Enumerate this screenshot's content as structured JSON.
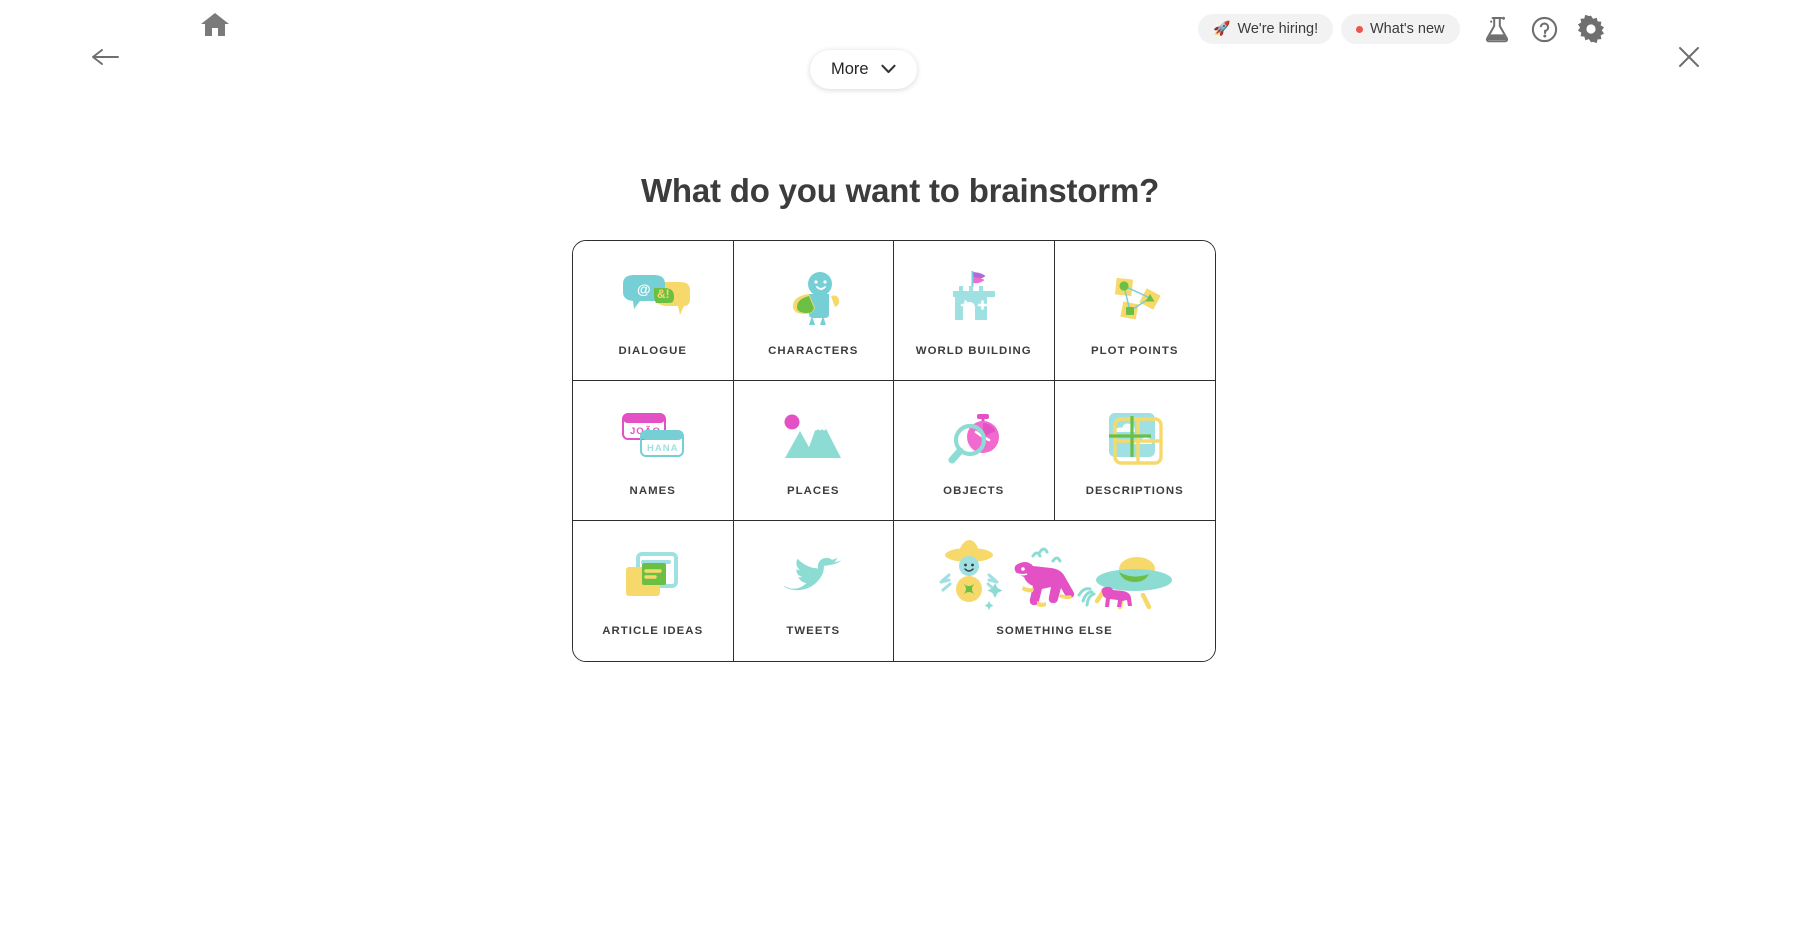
{
  "header": {
    "home_icon": "home-icon",
    "back_icon": "back-arrow-icon",
    "close_icon": "close-icon",
    "hiring_label": "We're hiring!",
    "hiring_icon": "rocket-icon",
    "whats_new_label": "What's new",
    "whats_new_dot_color": "#ef5350",
    "lab_icon": "flask-icon",
    "help_icon": "question-circle-icon",
    "gear_icon": "gear-icon",
    "pill_bg": "#f2f2f2"
  },
  "more_button": {
    "label": "More",
    "chevron_icon": "chevron-down-icon"
  },
  "main": {
    "title": "What do you want to brainstorm?"
  },
  "palette": {
    "teal": "#7fd6d8",
    "mint": "#8ddcd4",
    "yellow": "#f7d96b",
    "green": "#6cbf45",
    "magenta": "#e451c4",
    "pink": "#f06ad0",
    "purple": "#b06ad8",
    "ink": "#3c3c3c",
    "border": "#2e2e2e"
  },
  "grid": {
    "cells": [
      {
        "label": "DIALOGUE",
        "icon": "speech-bubbles-icon"
      },
      {
        "label": "CHARACTERS",
        "icon": "character-figure-icon"
      },
      {
        "label": "WORLD BUILDING",
        "icon": "castle-icon"
      },
      {
        "label": "PLOT POINTS",
        "icon": "connected-cards-icon"
      },
      {
        "label": "NAMES",
        "icon": "name-tags-icon",
        "tag_one": "JOÃO",
        "tag_two": "HANA"
      },
      {
        "label": "PLACES",
        "icon": "mountains-icon"
      },
      {
        "label": "OBJECTS",
        "icon": "magnifier-stopwatch-icon"
      },
      {
        "label": "DESCRIPTIONS",
        "icon": "window-panes-icon"
      },
      {
        "label": "ARTICLE IDEAS",
        "icon": "article-cards-icon"
      },
      {
        "label": "TWEETS",
        "icon": "bird-icon"
      },
      {
        "label": "SOMETHING ELSE",
        "icon": "wizard-dino-ufo-icon"
      }
    ]
  }
}
